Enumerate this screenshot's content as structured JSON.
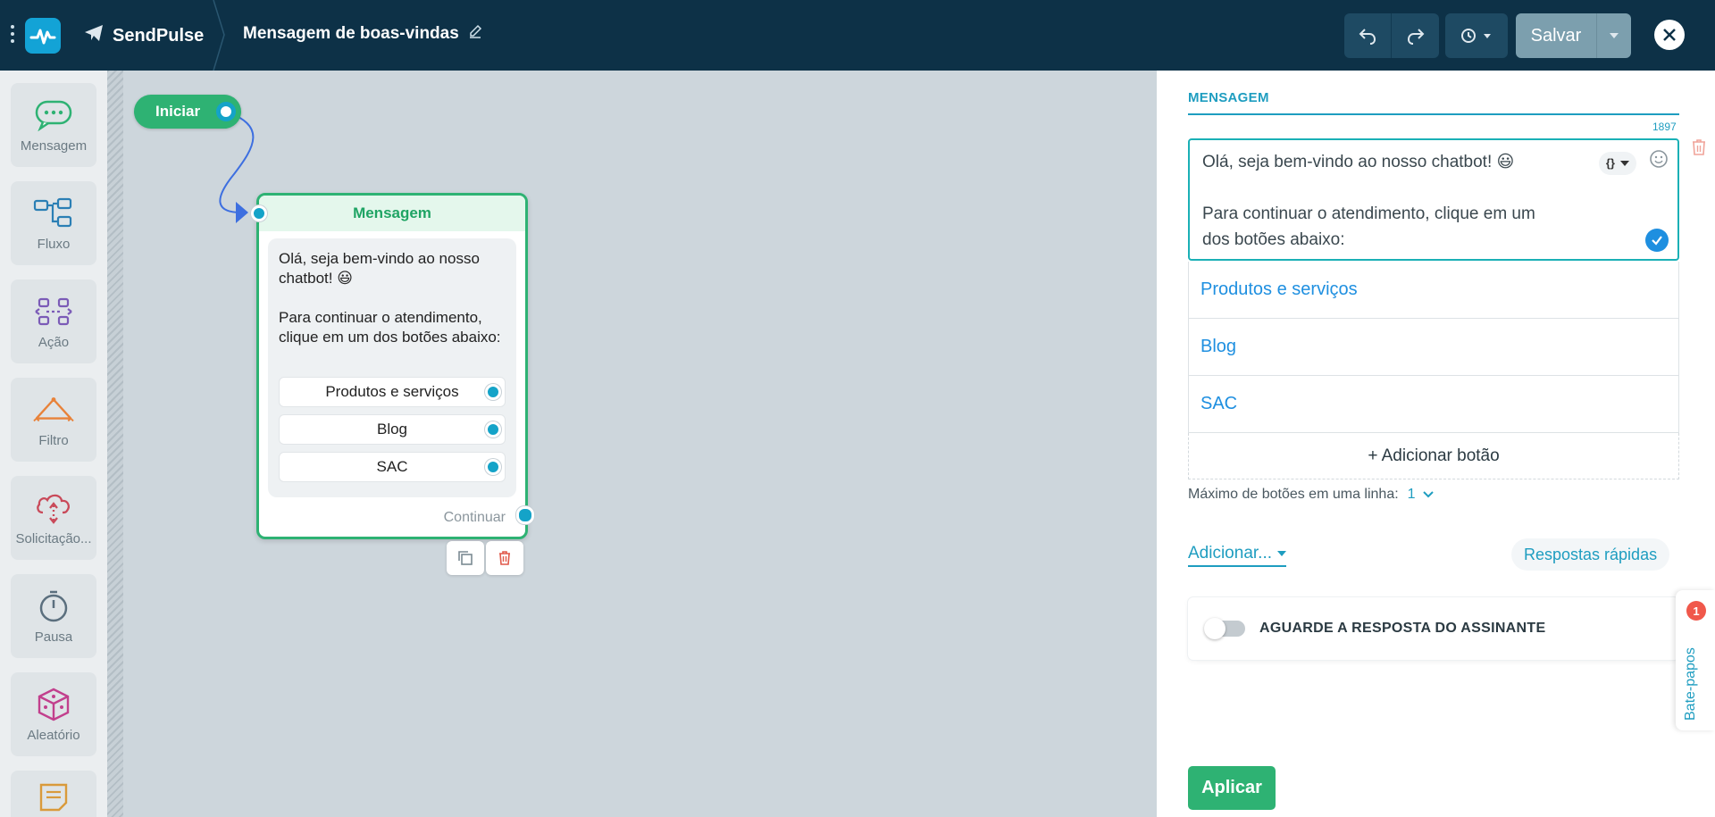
{
  "topbar": {
    "brand": "SendPulse",
    "flow_title": "Mensagem de boas-vindas",
    "save_label": "Salvar"
  },
  "sidebar": {
    "items": [
      {
        "label": "Mensagem",
        "icon": "message-icon"
      },
      {
        "label": "Fluxo",
        "icon": "flow-icon"
      },
      {
        "label": "Ação",
        "icon": "action-icon"
      },
      {
        "label": "Filtro",
        "icon": "filter-icon"
      },
      {
        "label": "Solicitação...",
        "icon": "request-icon"
      },
      {
        "label": "Pausa",
        "icon": "timer-icon"
      },
      {
        "label": "Aleatório",
        "icon": "dice-icon"
      },
      {
        "label": "",
        "icon": "note-icon"
      }
    ]
  },
  "canvas": {
    "start_label": "Iniciar",
    "node": {
      "title": "Mensagem",
      "text_line1": "Olá, seja bem-vindo ao nosso chatbot! 😃",
      "text_line2": "Para continuar o atendimento, clique em um dos botões abaixo:",
      "buttons": [
        "Produtos e serviços",
        "Blog",
        "SAC"
      ],
      "continue_label": "Continuar"
    }
  },
  "panel": {
    "title": "MENSAGEM",
    "char_counter": "1897",
    "message_line1": "Olá, seja bem-vindo ao nosso chatbot! 😃",
    "message_line2": "Para continuar o atendimento, clique em um\ndos botões abaixo:",
    "buttons": [
      "Produtos e serviços",
      "Blog",
      "SAC"
    ],
    "add_button_label": "+ Adicionar botão",
    "max_buttons_label": "Máximo de botões em uma linha:",
    "max_buttons_value": "1",
    "add_menu_label": "Adicionar...",
    "quick_replies_label": "Respostas rápidas",
    "wait_reply_label": "AGUARDE A RESPOSTA DO ASSINANTE",
    "wait_reply_enabled": false,
    "apply_label": "Aplicar"
  },
  "chat_tab": {
    "label": "Bate-papos",
    "badge": "1"
  },
  "colors": {
    "topbar": "#0d3147",
    "accent_green": "#2eb273",
    "accent_blue": "#1e9dc0",
    "link_blue": "#1e8fe0"
  }
}
